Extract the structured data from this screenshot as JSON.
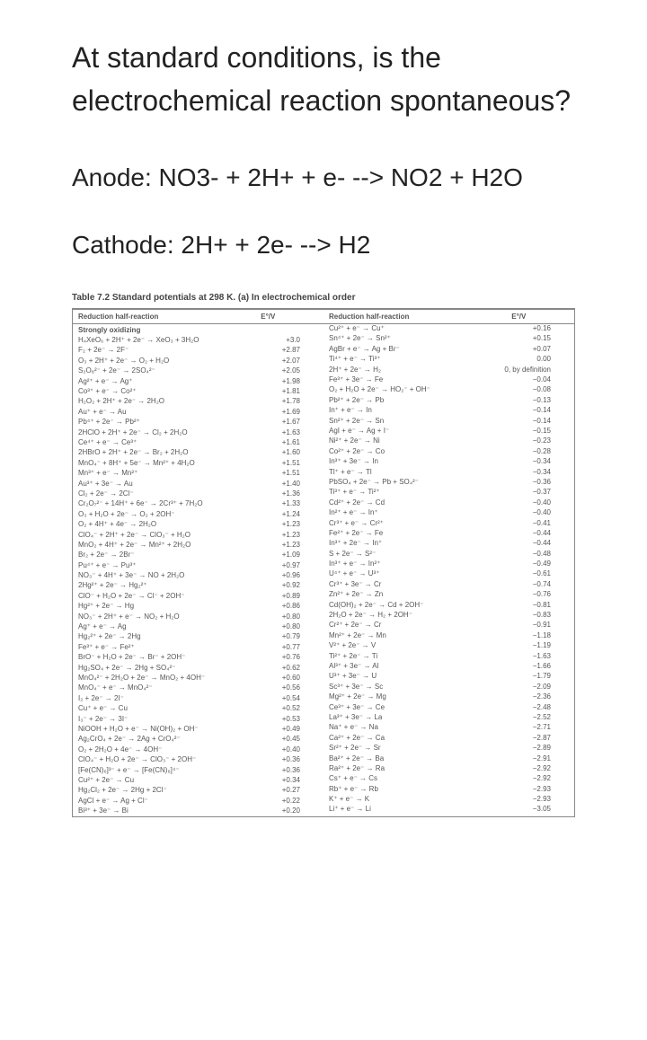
{
  "question": "At standard conditions, is the electrochemical reaction spontaneous?",
  "anode_line": "Anode: NO3- + 2H+ + e- --> NO2 + H2O",
  "cathode_line": "Cathode: 2H+ + 2e- --> H2",
  "table_caption": "Table 7.2 Standard potentials at 298 K. (a) In electrochemical order",
  "hdr_reduction": "Reduction half-reaction",
  "hdr_ev": "E°/V",
  "so_label": "Strongly oxidizing",
  "left_rows": [
    {
      "r": "H₄XeO₆ + 2H⁺ + 2e⁻ → XeO₃ + 3H₂O",
      "e": "+3.0"
    },
    {
      "r": "F₂ + 2e⁻ → 2F⁻",
      "e": "+2.87"
    },
    {
      "r": "O₃ + 2H⁺ + 2e⁻ → O₂ + H₂O",
      "e": "+2.07"
    },
    {
      "r": "S₂O₈²⁻ + 2e⁻ → 2SO₄²⁻",
      "e": "+2.05"
    },
    {
      "r": "Ag²⁺ + e⁻ → Ag⁺",
      "e": "+1.98"
    },
    {
      "r": "Co³⁺ + e⁻ → Co²⁺",
      "e": "+1.81"
    },
    {
      "r": "H₂O₂ + 2H⁺ + 2e⁻ → 2H₂O",
      "e": "+1.78"
    },
    {
      "r": "Au⁺ + e⁻ → Au",
      "e": "+1.69"
    },
    {
      "r": "Pb⁴⁺ + 2e⁻ → Pb²⁺",
      "e": "+1.67"
    },
    {
      "r": "2HClO + 2H⁺ + 2e⁻ → Cl₂ + 2H₂O",
      "e": "+1.63"
    },
    {
      "r": "Ce⁴⁺ + e⁻ → Ce³⁺",
      "e": "+1.61"
    },
    {
      "r": "2HBrO + 2H⁺ + 2e⁻ → Br₂ + 2H₂O",
      "e": "+1.60"
    },
    {
      "r": "MnO₄⁻ + 8H⁺ + 5e⁻ → Mn²⁺ + 4H₂O",
      "e": "+1.51"
    },
    {
      "r": "Mn³⁺ + e⁻ → Mn²⁺",
      "e": "+1.51"
    },
    {
      "r": "Au³⁺ + 3e⁻ → Au",
      "e": "+1.40"
    },
    {
      "r": "Cl₂ + 2e⁻ → 2Cl⁻",
      "e": "+1.36"
    },
    {
      "r": "Cr₂O₇²⁻ + 14H⁺ + 6e⁻ → 2Cr³⁺ + 7H₂O",
      "e": "+1.33"
    },
    {
      "r": "O₃ + H₂O + 2e⁻ → O₂ + 2OH⁻",
      "e": "+1.24"
    },
    {
      "r": "O₂ + 4H⁺ + 4e⁻ → 2H₂O",
      "e": "+1.23"
    },
    {
      "r": "ClO₄⁻ + 2H⁺ + 2e⁻ → ClO₃⁻ + H₂O",
      "e": "+1.23"
    },
    {
      "r": "MnO₂ + 4H⁺ + 2e⁻ → Mn²⁺ + 2H₂O",
      "e": "+1.23"
    },
    {
      "r": "Br₂ + 2e⁻ → 2Br⁻",
      "e": "+1.09"
    },
    {
      "r": "Pu⁴⁺ + e⁻ → Pu³⁺",
      "e": "+0.97"
    },
    {
      "r": "NO₃⁻ + 4H⁺ + 3e⁻ → NO + 2H₂O",
      "e": "+0.96"
    },
    {
      "r": "2Hg²⁺ + 2e⁻ → Hg₂²⁺",
      "e": "+0.92"
    },
    {
      "r": "ClO⁻ + H₂O + 2e⁻ → Cl⁻ + 2OH⁻",
      "e": "+0.89"
    },
    {
      "r": "Hg²⁺ + 2e⁻ → Hg",
      "e": "+0.86"
    },
    {
      "r": "NO₃⁻ + 2H⁺ + e⁻ → NO₂ + H₂O",
      "e": "+0.80"
    },
    {
      "r": "Ag⁺ + e⁻ → Ag",
      "e": "+0.80"
    },
    {
      "r": "Hg₂²⁺ + 2e⁻ → 2Hg",
      "e": "+0.79"
    },
    {
      "r": "Fe³⁺ + e⁻ → Fe²⁺",
      "e": "+0.77"
    },
    {
      "r": "BrO⁻ + H₂O + 2e⁻ → Br⁻ + 2OH⁻",
      "e": "+0.76"
    },
    {
      "r": "Hg₂SO₄ + 2e⁻ → 2Hg + SO₄²⁻",
      "e": "+0.62"
    },
    {
      "r": "MnO₄²⁻ + 2H₂O + 2e⁻ → MnO₂ + 4OH⁻",
      "e": "+0.60"
    },
    {
      "r": "MnO₄⁻ + e⁻ → MnO₄²⁻",
      "e": "+0.56"
    },
    {
      "r": "I₂ + 2e⁻ → 2I⁻",
      "e": "+0.54"
    },
    {
      "r": "Cu⁺ + e⁻ → Cu",
      "e": "+0.52"
    },
    {
      "r": "I₃⁻ + 2e⁻ → 3I⁻",
      "e": "+0.53"
    },
    {
      "r": "NiOOH + H₂O + e⁻ → Ni(OH)₂ + OH⁻",
      "e": "+0.49"
    },
    {
      "r": "Ag₂CrO₄ + 2e⁻ → 2Ag + CrO₄²⁻",
      "e": "+0.45"
    },
    {
      "r": "O₂ + 2H₂O + 4e⁻ → 4OH⁻",
      "e": "+0.40"
    },
    {
      "r": "ClO₄⁻ + H₂O + 2e⁻ → ClO₃⁻ + 2OH⁻",
      "e": "+0.36"
    },
    {
      "r": "[Fe(CN)₆]³⁻ + e⁻ → [Fe(CN)₆]⁴⁻",
      "e": "+0.36"
    },
    {
      "r": "Cu²⁺ + 2e⁻ → Cu",
      "e": "+0.34"
    },
    {
      "r": "Hg₂Cl₂ + 2e⁻ → 2Hg + 2Cl⁻",
      "e": "+0.27"
    },
    {
      "r": "AgCl + e⁻ → Ag + Cl⁻",
      "e": "+0.22"
    },
    {
      "r": "Bi³⁺ + 3e⁻ → Bi",
      "e": "+0.20"
    }
  ],
  "right_rows": [
    {
      "r": "Cu²⁺ + e⁻ → Cu⁺",
      "e": "+0.16"
    },
    {
      "r": "Sn⁴⁺ + 2e⁻ → Sn²⁺",
      "e": "+0.15"
    },
    {
      "r": "AgBr + e⁻ → Ag + Br⁻",
      "e": "+0.07"
    },
    {
      "r": "Ti⁴⁺ + e⁻ → Ti³⁺",
      "e": "0.00"
    },
    {
      "r": "2H⁺ + 2e⁻ → H₂",
      "e": "0, by definition"
    },
    {
      "r": "Fe³⁺ + 3e⁻ → Fe",
      "e": "−0.04"
    },
    {
      "r": "O₂ + H₂O + 2e⁻ → HO₂⁻ + OH⁻",
      "e": "−0.08"
    },
    {
      "r": "Pb²⁺ + 2e⁻ → Pb",
      "e": "−0.13"
    },
    {
      "r": "In⁺ + e⁻ → In",
      "e": "−0.14"
    },
    {
      "r": "Sn²⁺ + 2e⁻ → Sn",
      "e": "−0.14"
    },
    {
      "r": "AgI + e⁻ → Ag + I⁻",
      "e": "−0.15"
    },
    {
      "r": "Ni²⁺ + 2e⁻ → Ni",
      "e": "−0.23"
    },
    {
      "r": "Co²⁺ + 2e⁻ → Co",
      "e": "−0.28"
    },
    {
      "r": "In³⁺ + 3e⁻ → In",
      "e": "−0.34"
    },
    {
      "r": "Tl⁺ + e⁻ → Tl",
      "e": "−0.34"
    },
    {
      "r": "PbSO₄ + 2e⁻ → Pb + SO₄²⁻",
      "e": "−0.36"
    },
    {
      "r": "Ti³⁺ + e⁻ → Ti²⁺",
      "e": "−0.37"
    },
    {
      "r": "Cd²⁺ + 2e⁻ → Cd",
      "e": "−0.40"
    },
    {
      "r": "In²⁺ + e⁻ → In⁺",
      "e": "−0.40"
    },
    {
      "r": "Cr³⁺ + e⁻ → Cr²⁺",
      "e": "−0.41"
    },
    {
      "r": "Fe²⁺ + 2e⁻ → Fe",
      "e": "−0.44"
    },
    {
      "r": "In³⁺ + 2e⁻ → In⁺",
      "e": "−0.44"
    },
    {
      "r": "S + 2e⁻ → S²⁻",
      "e": "−0.48"
    },
    {
      "r": "In³⁺ + e⁻ → In²⁺",
      "e": "−0.49"
    },
    {
      "r": "U⁴⁺ + e⁻ → U³⁺",
      "e": "−0.61"
    },
    {
      "r": "Cr³⁺ + 3e⁻ → Cr",
      "e": "−0.74"
    },
    {
      "r": "Zn²⁺ + 2e⁻ → Zn",
      "e": "−0.76"
    },
    {
      "r": "Cd(OH)₂ + 2e⁻ → Cd + 2OH⁻",
      "e": "−0.81"
    },
    {
      "r": "2H₂O + 2e⁻ → H₂ + 2OH⁻",
      "e": "−0.83"
    },
    {
      "r": "Cr²⁺ + 2e⁻ → Cr",
      "e": "−0.91"
    },
    {
      "r": "Mn²⁺ + 2e⁻ → Mn",
      "e": "−1.18"
    },
    {
      "r": "V²⁺ + 2e⁻ → V",
      "e": "−1.19"
    },
    {
      "r": "Ti²⁺ + 2e⁻ → Ti",
      "e": "−1.63"
    },
    {
      "r": "Al³⁺ + 3e⁻ → Al",
      "e": "−1.66"
    },
    {
      "r": "U³⁺ + 3e⁻ → U",
      "e": "−1.79"
    },
    {
      "r": "Sc³⁺ + 3e⁻ → Sc",
      "e": "−2.09"
    },
    {
      "r": "Mg²⁺ + 2e⁻ → Mg",
      "e": "−2.36"
    },
    {
      "r": "Ce³⁺ + 3e⁻ → Ce",
      "e": "−2.48"
    },
    {
      "r": "La³⁺ + 3e⁻ → La",
      "e": "−2.52"
    },
    {
      "r": "Na⁺ + e⁻ → Na",
      "e": "−2.71"
    },
    {
      "r": "Ca²⁺ + 2e⁻ → Ca",
      "e": "−2.87"
    },
    {
      "r": "Sr²⁺ + 2e⁻ → Sr",
      "e": "−2.89"
    },
    {
      "r": "Ba²⁺ + 2e⁻ → Ba",
      "e": "−2.91"
    },
    {
      "r": "Ra²⁺ + 2e⁻ → Ra",
      "e": "−2.92"
    },
    {
      "r": "Cs⁺ + e⁻ → Cs",
      "e": "−2.92"
    },
    {
      "r": "Rb⁺ + e⁻ → Rb",
      "e": "−2.93"
    },
    {
      "r": "K⁺ + e⁻ → K",
      "e": "−2.93"
    },
    {
      "r": "Li⁺ + e⁻ → Li",
      "e": "−3.05"
    }
  ]
}
